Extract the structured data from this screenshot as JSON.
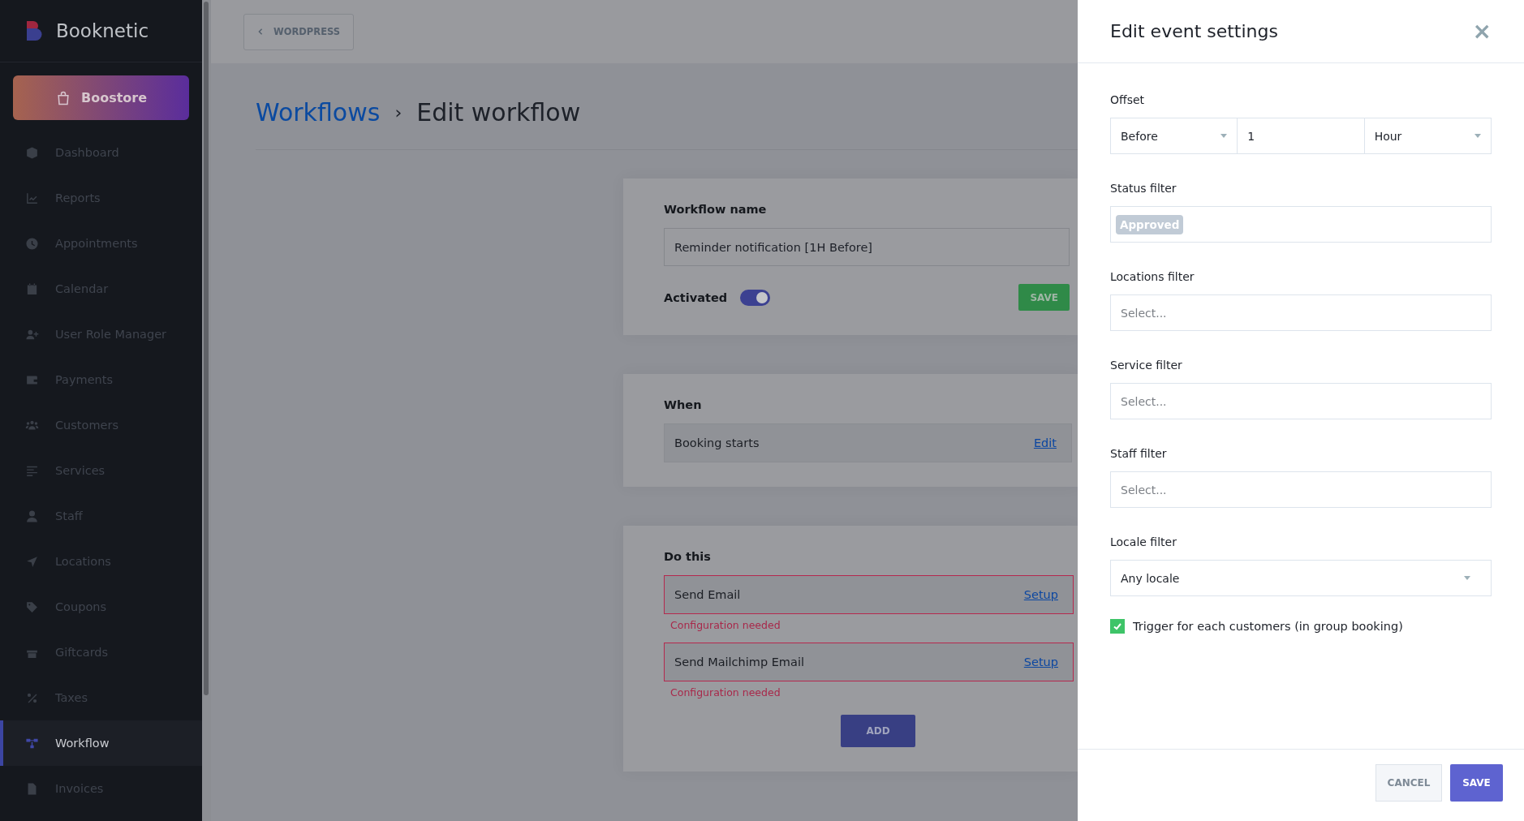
{
  "sidebar": {
    "brand": "Booknetic",
    "store_button": "Boostore",
    "items": [
      {
        "label": "Dashboard",
        "selected": false
      },
      {
        "label": "Reports",
        "selected": false
      },
      {
        "label": "Appointments",
        "selected": false
      },
      {
        "label": "Calendar",
        "selected": false
      },
      {
        "label": "User Role Manager",
        "selected": false
      },
      {
        "label": "Payments",
        "selected": false
      },
      {
        "label": "Customers",
        "selected": false
      },
      {
        "label": "Services",
        "selected": false
      },
      {
        "label": "Staff",
        "selected": false
      },
      {
        "label": "Locations",
        "selected": false
      },
      {
        "label": "Coupons",
        "selected": false
      },
      {
        "label": "Giftcards",
        "selected": false
      },
      {
        "label": "Taxes",
        "selected": false
      },
      {
        "label": "Workflow",
        "selected": true
      },
      {
        "label": "Invoices",
        "selected": false
      }
    ]
  },
  "top_bar": {
    "back_button": "WORDPRESS"
  },
  "breadcrumb": {
    "parent": "Workflows",
    "separator": "›",
    "current": "Edit workflow"
  },
  "workflow_card": {
    "name_label": "Workflow name",
    "name_value": "Reminder notification [1H Before]",
    "activated_label": "Activated",
    "activated": true,
    "save_button": "SAVE"
  },
  "when_card": {
    "title": "When",
    "trigger": "Booking starts",
    "edit_link": "Edit"
  },
  "actions_card": {
    "title": "Do this",
    "actions": [
      {
        "label": "Send Email",
        "link": "Setup",
        "error": "Configuration needed"
      },
      {
        "label": "Send Mailchimp Email",
        "link": "Setup",
        "error": "Configuration needed"
      }
    ],
    "add_button": "ADD"
  },
  "drawer": {
    "title": "Edit event settings",
    "close": "×",
    "fields": [
      {
        "label": "Offset",
        "kind": "offset",
        "direction": "Before",
        "amount": "1",
        "unit": "Hour"
      },
      {
        "label": "Status filter",
        "kind": "tags",
        "tags": [
          "Approved"
        ]
      },
      {
        "label": "Locations filter",
        "kind": "multiselect",
        "placeholder": "Select..."
      },
      {
        "label": "Service filter",
        "kind": "multiselect",
        "placeholder": "Select..."
      },
      {
        "label": "Staff filter",
        "kind": "multiselect",
        "placeholder": "Select..."
      },
      {
        "label": "Locale filter",
        "kind": "select",
        "value": "Any locale"
      }
    ],
    "checkbox": {
      "label": "Trigger for each customers (in group booking)",
      "checked": true
    },
    "cancel_button": "CANCEL",
    "save_button": "SAVE"
  }
}
